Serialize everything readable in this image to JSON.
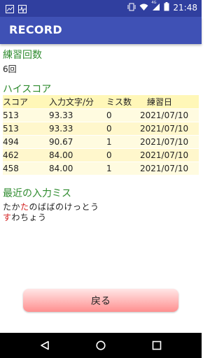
{
  "status_bar": {
    "time": "21:48",
    "network_label": "4G"
  },
  "app_bar": {
    "title": "RECORD"
  },
  "practice": {
    "heading": "練習回数",
    "count": "6回"
  },
  "highscore": {
    "heading": "ハイスコア",
    "columns": [
      "スコア",
      "入力文字/分",
      "ミス数",
      "練習日"
    ],
    "rows": [
      [
        "513",
        "93.33",
        "0",
        "2021/07/10"
      ],
      [
        "513",
        "93.33",
        "0",
        "2021/07/10"
      ],
      [
        "494",
        "90.67",
        "1",
        "2021/07/10"
      ],
      [
        "462",
        "84.00",
        "0",
        "2021/07/10"
      ],
      [
        "458",
        "84.00",
        "1",
        "2021/07/10"
      ]
    ]
  },
  "recent_misses": {
    "heading": "最近の入力ミス",
    "lines": [
      {
        "before": "たか",
        "miss": "た",
        "after": "のばばのけっとう"
      },
      {
        "before": "",
        "miss": "す",
        "after": "わちょう"
      }
    ]
  },
  "back_button": {
    "label": "戻る"
  },
  "colors": {
    "status_bar": "#303F9F",
    "app_bar": "#3F51B5",
    "heading": "#2e8b2e",
    "miss": "#d32020",
    "button": "#ff9a9a"
  }
}
